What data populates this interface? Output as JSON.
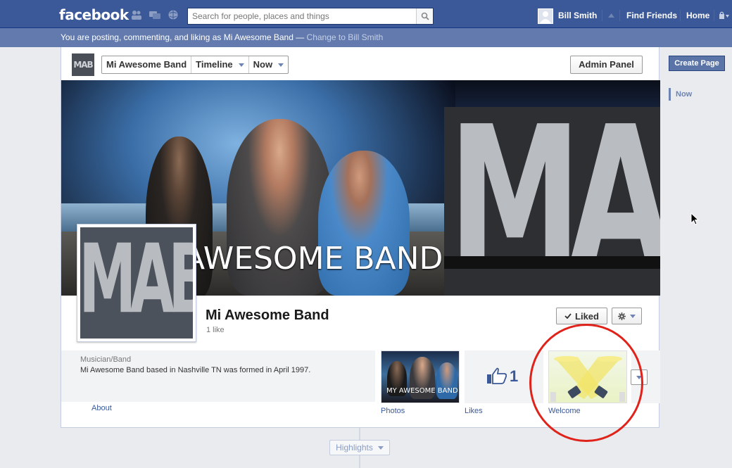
{
  "topbar": {
    "logo": "facebook",
    "search_placeholder": "Search for people, places and things",
    "user_name": "Bill Smith",
    "find_friends": "Find Friends",
    "home": "Home",
    "bg_color": "#3b5998"
  },
  "voice_bar": {
    "text": "You are posting, commenting, and liking as Mi Awesome Band — ",
    "link": "Change to Bill Smith"
  },
  "page_header": {
    "thumb_text": "MAB",
    "selector": [
      "Mi Awesome Band",
      "Timeline",
      "Now"
    ],
    "admin_panel": "Admin Panel"
  },
  "cover": {
    "band_text": "AWESOME BAND",
    "logo_text": "MAB"
  },
  "profile": {
    "pic_text": "MAB",
    "name": "Mi Awesome Band",
    "likes": "1 like",
    "liked_button": "Liked"
  },
  "info": {
    "category": "Musician/Band",
    "about": "Mi Awesome Band based in Nashville TN was formed in April 1997.",
    "about_link": "About"
  },
  "apps": [
    {
      "label": "Photos",
      "caption": "MY AWESOME BAND"
    },
    {
      "label": "Likes",
      "count": "1"
    },
    {
      "label": "Welcome"
    }
  ],
  "sidebar": {
    "create_page": "Create Page",
    "now": "Now"
  },
  "highlights": "Highlights",
  "annotation_color": "#e0231a"
}
